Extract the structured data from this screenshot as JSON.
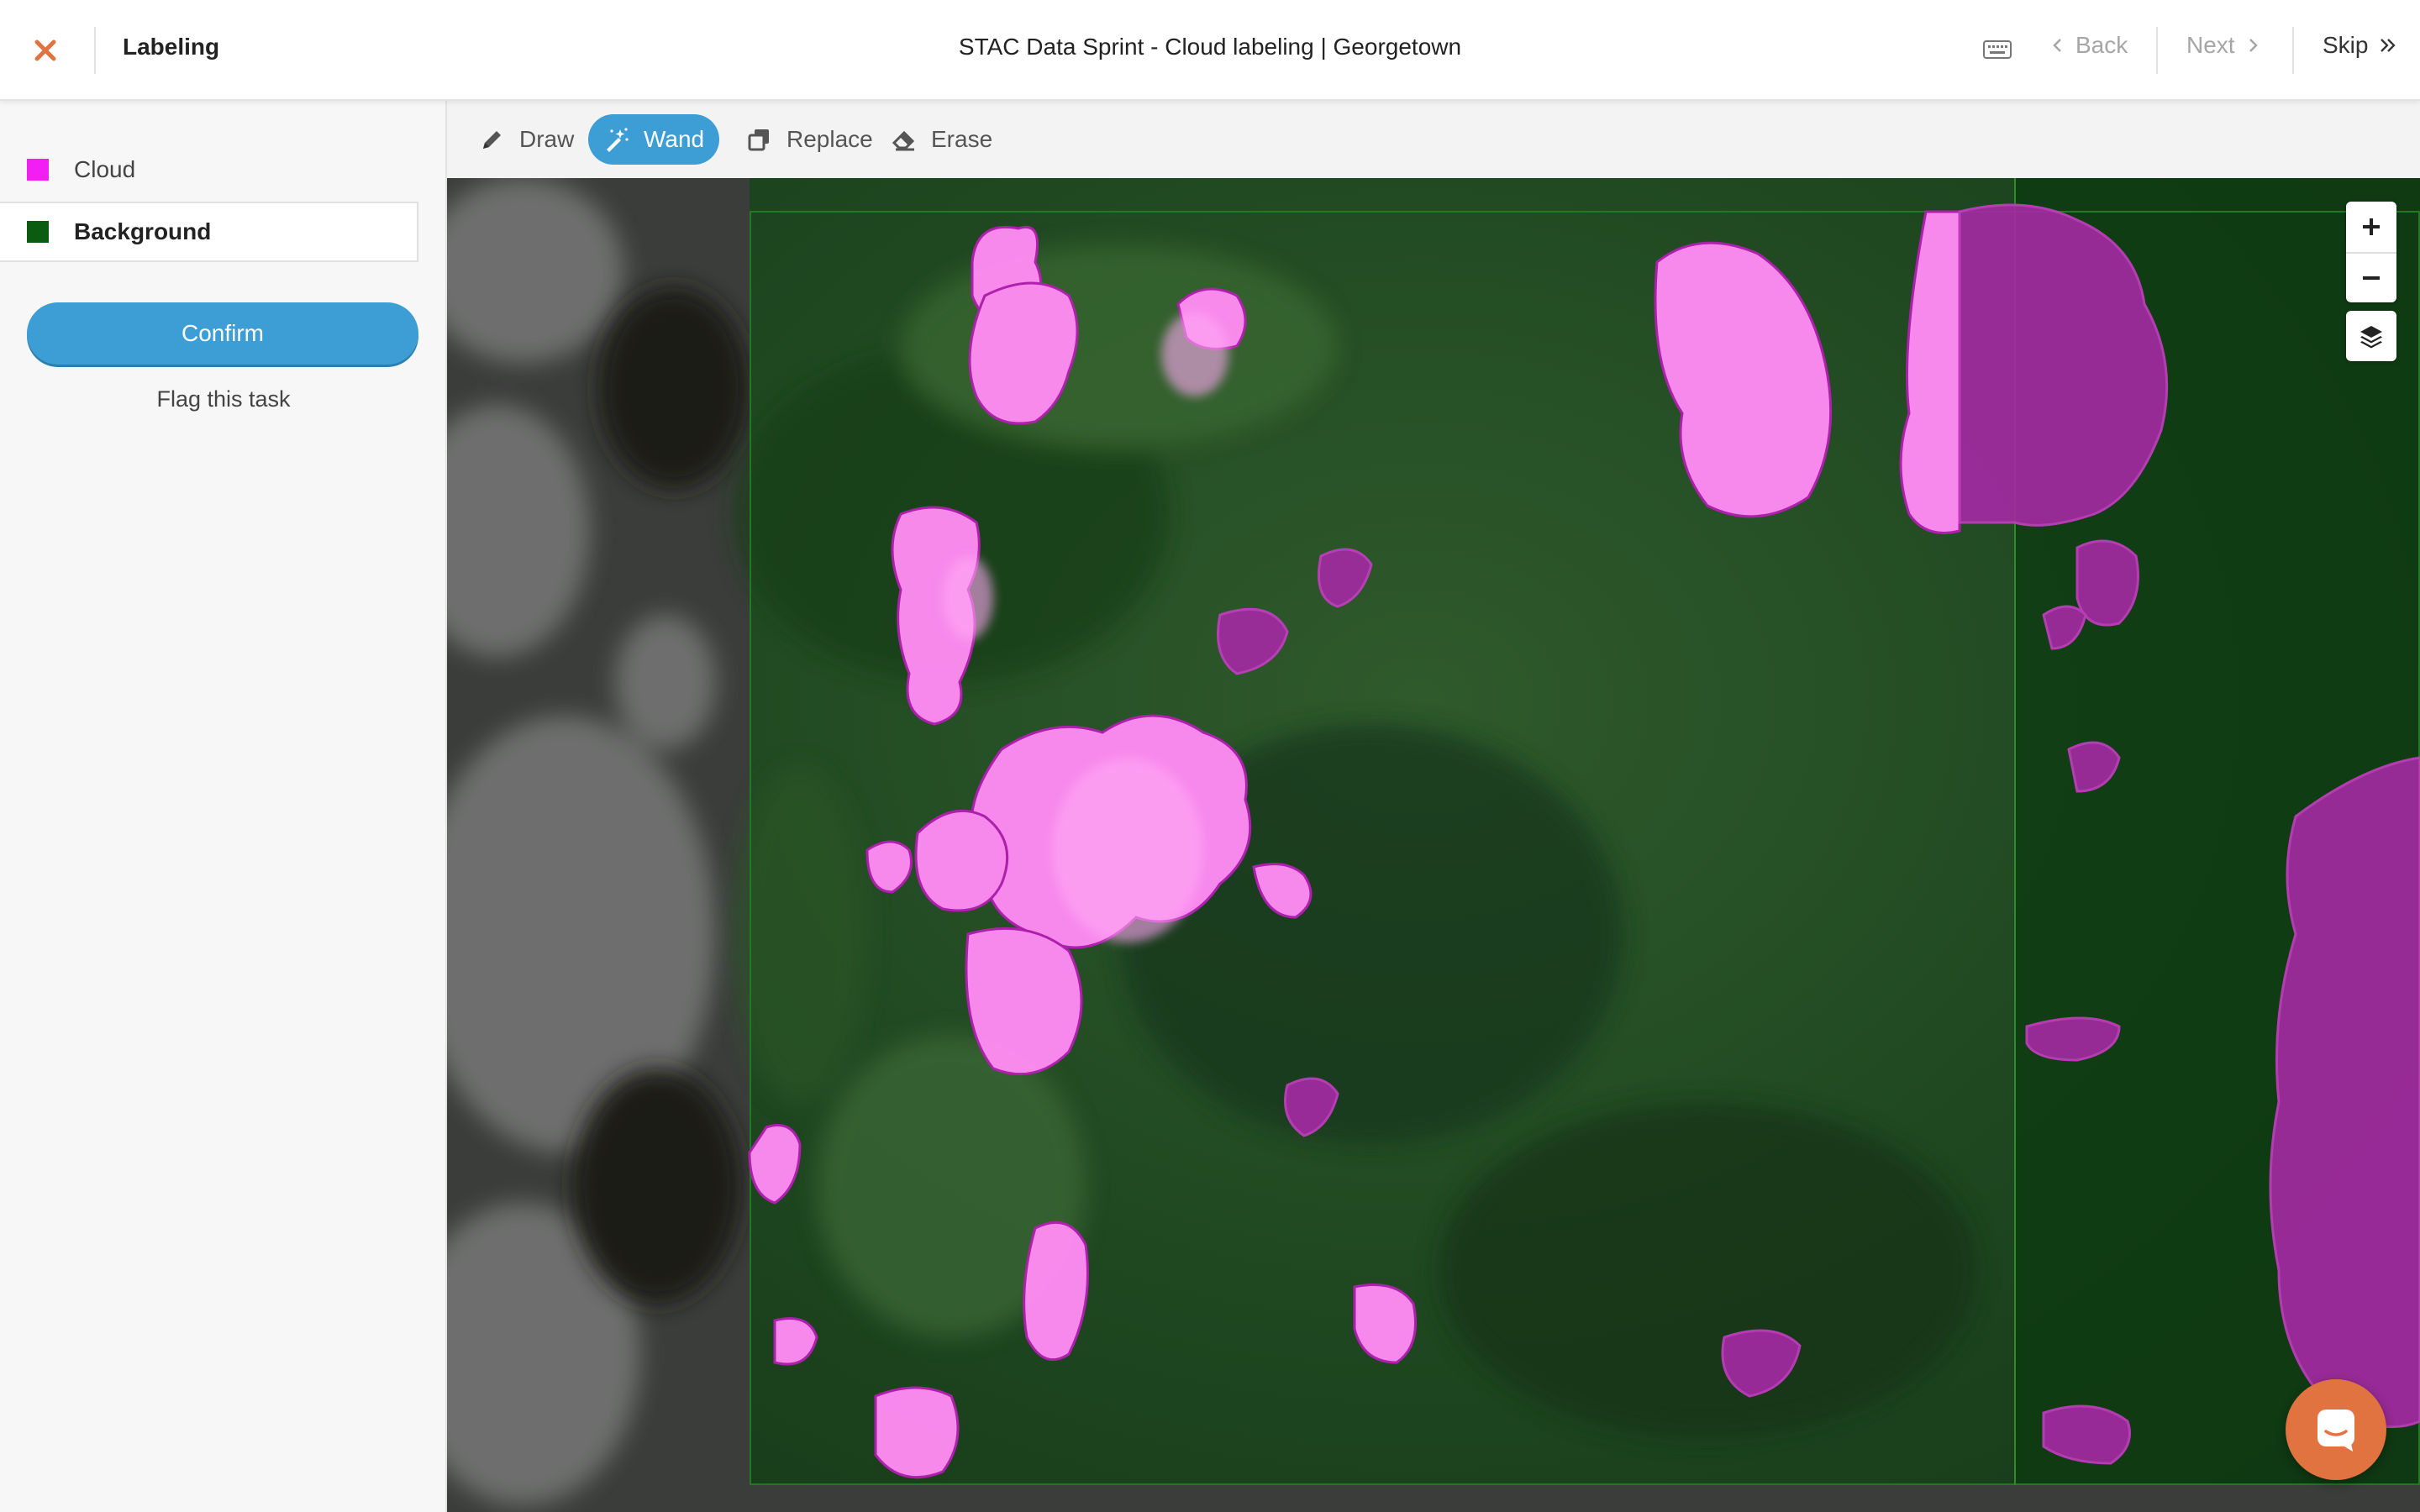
{
  "header": {
    "app_title": "Labeling",
    "task_title": "STAC Data Sprint - Cloud labeling | Georgetown",
    "back_label": "Back",
    "next_label": "Next",
    "skip_label": "Skip",
    "accent_color": "#e0733f"
  },
  "sidebar": {
    "classes": [
      {
        "label": "Cloud",
        "color": "#f21ff5",
        "selected": false
      },
      {
        "label": "Background",
        "color": "#0b5b10",
        "selected": true
      }
    ],
    "confirm_label": "Confirm",
    "flag_label": "Flag this task"
  },
  "toolbar": {
    "tools": [
      {
        "label": "Draw",
        "icon": "pencil-icon",
        "active": false
      },
      {
        "label": "Wand",
        "icon": "magic-wand-icon",
        "active": true
      },
      {
        "label": "Replace",
        "icon": "replace-icon",
        "active": false
      },
      {
        "label": "Erase",
        "icon": "eraser-icon",
        "active": false
      }
    ]
  },
  "map_controls": {
    "zoom_in_icon": "plus-icon",
    "zoom_out_icon": "minus-icon",
    "layers_icon": "layers-icon",
    "chat_icon": "chat-icon"
  }
}
